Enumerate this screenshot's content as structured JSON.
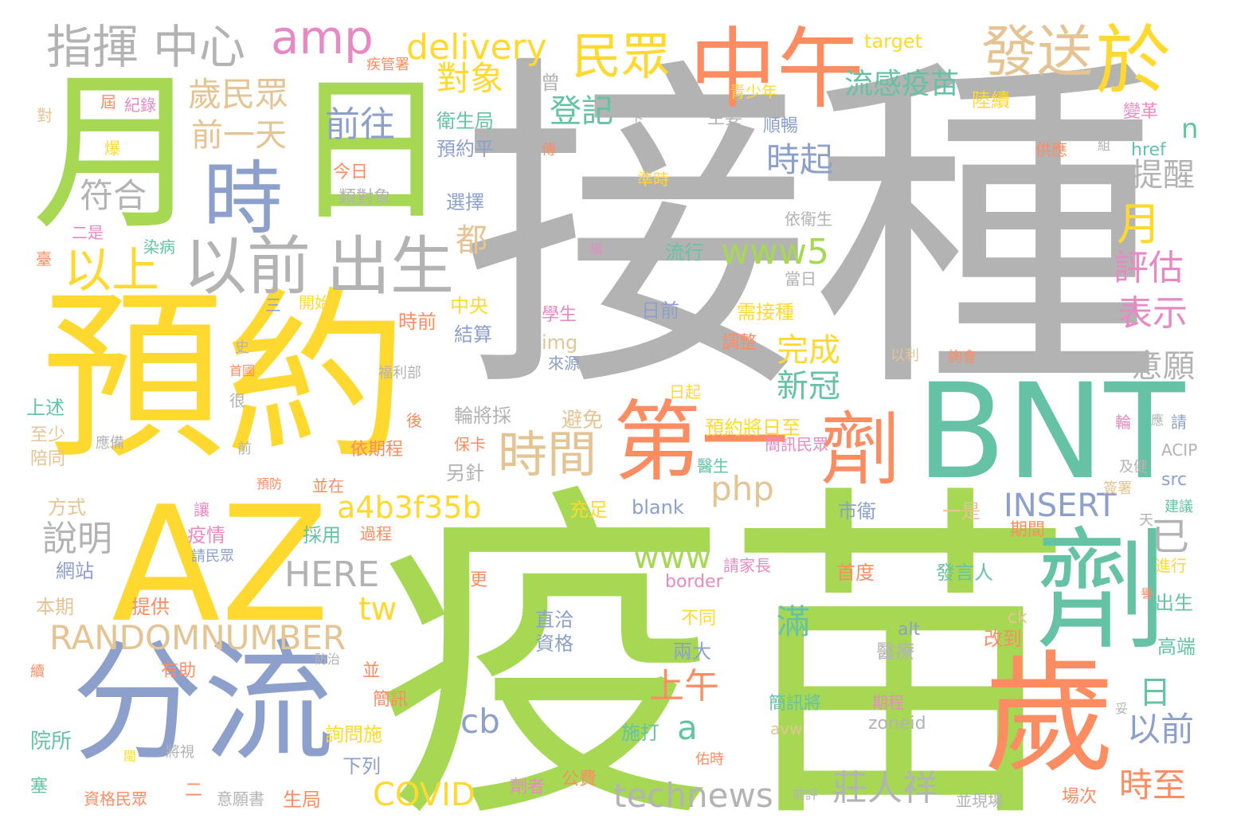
{
  "palette": {
    "gray": "#b3b3b3",
    "yellow": "#ffd92f",
    "green": "#a6d854",
    "blue": "#8da0cb",
    "orange": "#fc8d62",
    "teal": "#66c2a5",
    "pink": "#e78ac3",
    "tan": "#e5c494",
    "background": "#ffffff"
  },
  "words": {
    "w1": "接種",
    "w2": "疫苗",
    "w3": "預約",
    "w4": "BNT",
    "w5": "AZ",
    "w6": "分流",
    "w7": "月",
    "w8": "日",
    "w9": "歲",
    "w10": "劑",
    "w11": "中午",
    "w12": "第一",
    "w13": "劑",
    "w14": "時",
    "w15": "於",
    "w16": "以前",
    "w17": "出生",
    "w18": "發送",
    "w19": "指揮",
    "w20": "中心",
    "w21": "民眾",
    "w22": "amp",
    "w23": "delivery",
    "w24": "以上",
    "w25": "時間",
    "w26": "歲民眾",
    "w27": "前往",
    "w28": "符合",
    "w29": "前一天",
    "w30": "對象",
    "w31": "流感疫苗",
    "w32": "登記",
    "w33": "時起",
    "w34": "提醒",
    "w35": "月",
    "w36": "評估",
    "w37": "表示",
    "w38": "意願",
    "w39": "www5",
    "w40": "都",
    "w41": "完成",
    "w42": "新冠",
    "w43": "php",
    "w44": "a4b3f35b",
    "w45": "INSERT",
    "w46": "已",
    "w47": "說明",
    "w48": "HERE",
    "w49": "www",
    "w50": "tw",
    "w51": "RANDOMNUMBER",
    "w52": "滿",
    "w53": "上午",
    "w54": "cb",
    "w55": "a",
    "w56": "日",
    "w57": "以前",
    "w58": "時至",
    "w59": "COVID",
    "w60": "technews",
    "w61": "莊人祥",
    "w62": "n",
    "w63": "target",
    "w64": "未曾",
    "w65": "衛生局",
    "w66": "預約平",
    "w67": "今日",
    "w68": "類對象",
    "w69": "選擇",
    "w70": "準時",
    "w71": "各縣",
    "w72": "主要",
    "w73": "順暢",
    "w74": "青少年",
    "w75": "陸續",
    "w76": "疾管署",
    "w77": "變革",
    "w78": "供應",
    "w79": "href",
    "w80": "卡",
    "w81": "流行",
    "w82": "依衛生",
    "w83": "日前",
    "w84": "當日",
    "w85": "需接種",
    "w86": "中央",
    "w87": "時前",
    "w88": "結算",
    "w89": "img",
    "w90": "學生",
    "w91": "來源",
    "w92": "調整",
    "w93": "詢會",
    "w94": "以利",
    "w95": "福利部",
    "w96": "日起",
    "w97": "輪將採",
    "w98": "避免",
    "w99": "預約將日至",
    "w100": "簡訊民眾",
    "w101": "保卡",
    "w102": "另針",
    "w103": "依期程",
    "w104": "醫生",
    "w105": "並在",
    "w106": "blank",
    "w107": "充足",
    "w108": "市衛",
    "w109": "一是",
    "w110": "過程",
    "w111": "採用",
    "w112": "疫情",
    "w113": "請民眾",
    "w114": "請家長",
    "w115": "首度",
    "w116": "發言人",
    "w117": "border",
    "w118": "直洽",
    "w119": "資格",
    "w120": "不同",
    "w121": "兩大",
    "w122": "alt",
    "w123": "醫療",
    "w124": "改到",
    "w125": "ck",
    "w126": "並",
    "w127": "簡訊",
    "w128": "簡訊將",
    "w129": "期程",
    "w130": "詢問施",
    "w131": "施打",
    "w132": "avw",
    "w133": "zoneid",
    "w134": "下列",
    "w135": "劑者",
    "w136": "公費",
    "w137": "生局",
    "w138": "資格民眾",
    "w139": "意願書",
    "w140": "前評",
    "w141": "並現場",
    "w142": "場次",
    "w143": "紀錄",
    "w144": "屆",
    "w145": "爆",
    "w146": "對",
    "w147": "二是",
    "w148": "染病",
    "w149": "臺",
    "w150": "傳",
    "w151": "隔",
    "w152": "開始",
    "w153": "三",
    "w154": "史",
    "w155": "首國",
    "w156": "很",
    "w157": "後",
    "w158": "上述",
    "w159": "至少",
    "w160": "陪同",
    "w161": "應備",
    "w162": "前",
    "w163": "預防",
    "w164": "方式",
    "w165": "讓",
    "w166": "網站",
    "w167": "本期",
    "w168": "提供",
    "w169": "有助",
    "w170": "防治",
    "w171": "續",
    "w172": "院所",
    "w173": "塞",
    "w174": "二",
    "w175": "閩",
    "w176": "將視",
    "w177": "佑時",
    "w178": "更",
    "w179": "ACIP",
    "w180": "src",
    "w181": "及健",
    "w182": "簽署",
    "w183": "建議",
    "w184": "天",
    "w185": "期間",
    "w186": "進行",
    "w187": "出生",
    "w188": "高端",
    "w189": "妥",
    "w190": "輪",
    "w191": "應",
    "w192": "請",
    "w193": "組",
    "w194": "譽"
  }
}
